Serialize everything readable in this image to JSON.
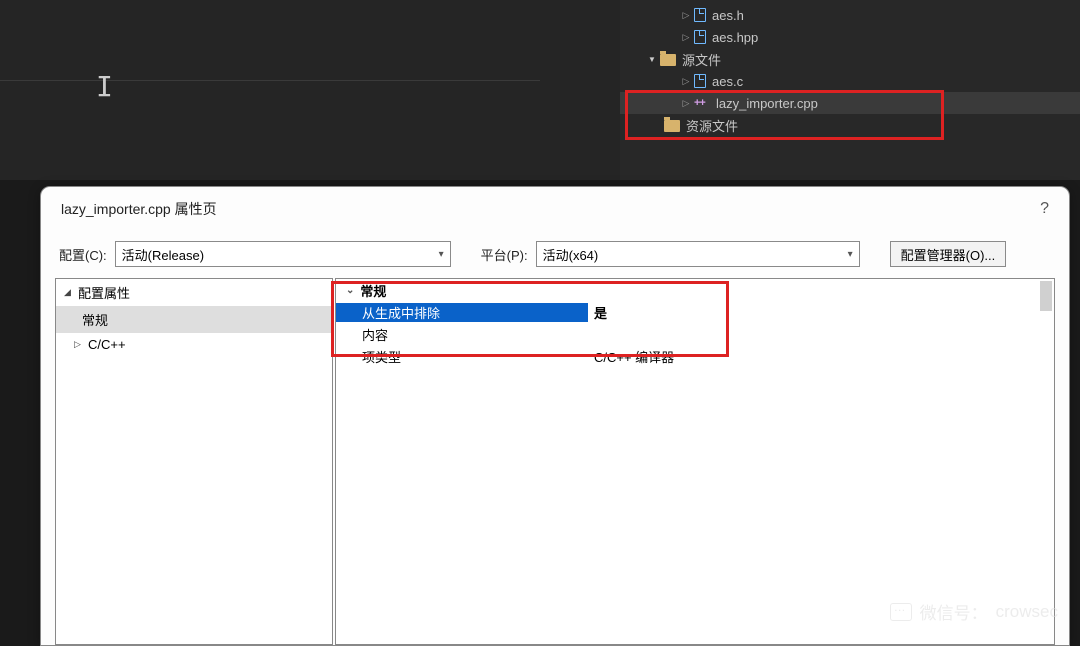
{
  "tree": {
    "items": [
      {
        "name": "aes.h",
        "type": "file",
        "indent": 60
      },
      {
        "name": "aes.hpp",
        "type": "file",
        "indent": 60
      }
    ],
    "source_folder": "源文件",
    "sources": [
      {
        "name": "aes.c",
        "type": "file"
      },
      {
        "name": "lazy_importer.cpp",
        "type": "cpp",
        "selected": true
      }
    ],
    "resource_folder": "资源文件"
  },
  "dialog": {
    "title": "lazy_importer.cpp 属性页",
    "help": "?",
    "config_label": "配置(C):",
    "config_value": "活动(Release)",
    "platform_label": "平台(P):",
    "platform_value": "活动(x64)",
    "manager_btn": "配置管理器(O)..."
  },
  "leftTree": {
    "root": "配置属性",
    "general": "常规",
    "cpp": "C/C++"
  },
  "grid": {
    "group": "常规",
    "rows": [
      {
        "label": "从生成中排除",
        "value": "是",
        "selected": true
      },
      {
        "label": "内容",
        "value": ""
      },
      {
        "label": "项类型",
        "value": "C/C++ 编译器"
      }
    ]
  },
  "watermark": {
    "label": "微信号：",
    "id": "crowsec"
  }
}
